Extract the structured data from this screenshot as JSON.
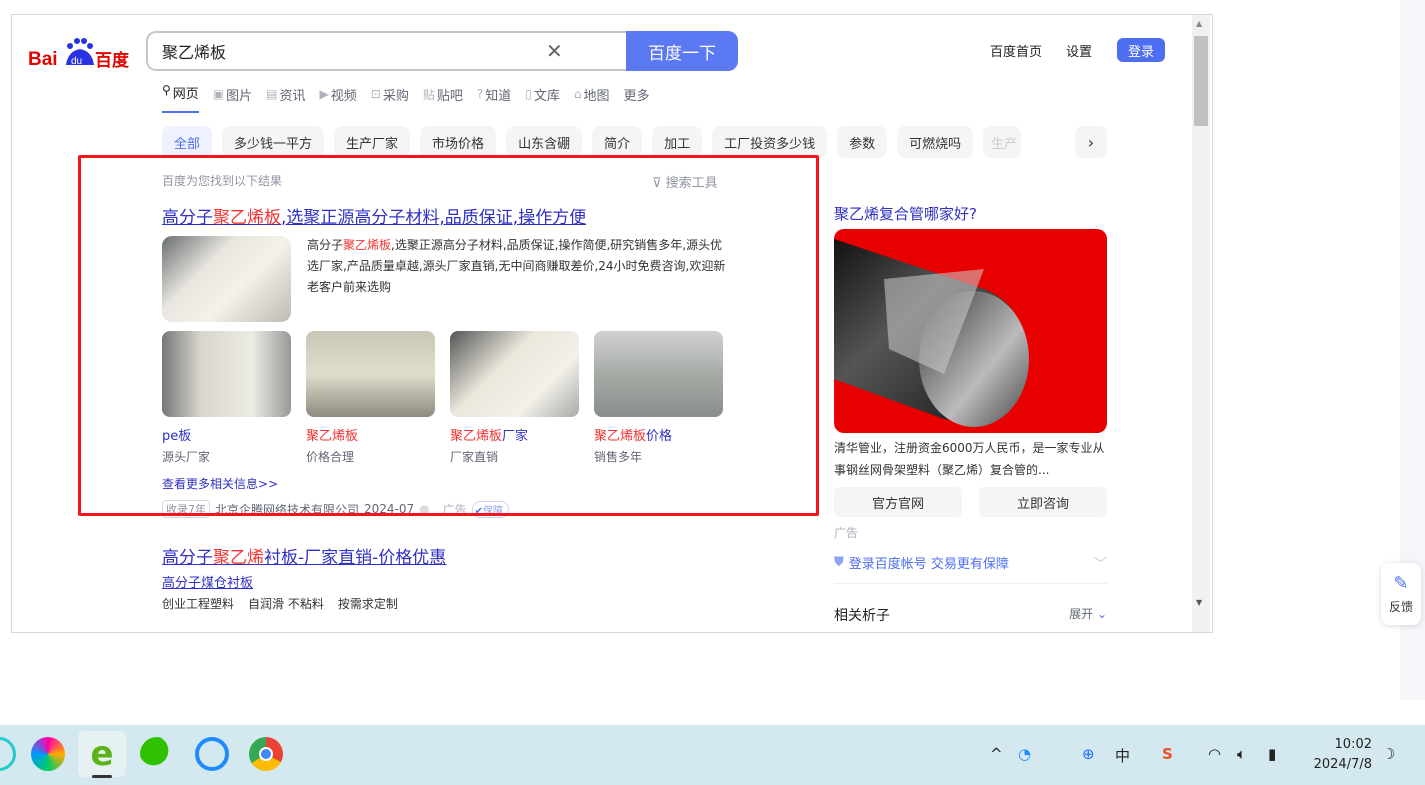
{
  "search": {
    "query": "聚乙烯板",
    "button": "百度一下",
    "logo_text": "Bai百度"
  },
  "top_links": {
    "home": "百度首页",
    "settings": "设置",
    "login": "登录"
  },
  "tabs": [
    {
      "label": "网页",
      "icon": "search-icon"
    },
    {
      "label": "图片",
      "icon": "image-icon"
    },
    {
      "label": "资讯",
      "icon": "news-icon"
    },
    {
      "label": "视频",
      "icon": "video-icon"
    },
    {
      "label": "采购",
      "icon": "bag-icon"
    },
    {
      "label": "贴吧",
      "icon": "tieba-icon"
    },
    {
      "label": "知道",
      "icon": "question-icon"
    },
    {
      "label": "文库",
      "icon": "doc-icon"
    },
    {
      "label": "地图",
      "icon": "map-icon"
    },
    {
      "label": "更多",
      "icon": ""
    }
  ],
  "chips": [
    "全部",
    "多少钱一平方",
    "生产厂家",
    "市场价格",
    "山东含硼",
    "简介",
    "加工",
    "工厂投资多少钱",
    "参数",
    "可燃烧吗",
    "生产"
  ],
  "results_header": {
    "found": "百度为您找到以下结果",
    "tools": "搜索工具"
  },
  "result1": {
    "title_pre": "高分子",
    "title_hl": "聚乙烯板",
    "title_post": ",选聚正源高分子材料,品质保证,操作方便",
    "desc_pre": "高分子",
    "desc_hl": "聚乙烯板",
    "desc_post": ",选聚正源高分子材料,品质保证,操作简便,研究销售多年,源头优选厂家,产品质量卓越,源头厂家直销,无中间商赚取差价,24小时免费咨询,欢迎新老客户前来选购",
    "gallery": [
      {
        "hl": "",
        "label": "pe板",
        "sub": "源头厂家"
      },
      {
        "hl": "聚乙烯板",
        "label": "",
        "sub": "价格合理"
      },
      {
        "hl": "聚乙烯板",
        "label": "厂家",
        "sub": "厂家直销"
      },
      {
        "hl": "聚乙烯板",
        "label": "价格",
        "sub": "销售多年"
      }
    ],
    "more": "查看更多相关信息>>",
    "badge": "收录7年",
    "source": "北京企腾网络技术有限公司",
    "date": "2024-07",
    "ad": "广告",
    "guarantee": "保障"
  },
  "result2": {
    "title_pre": "高分子",
    "title_hl": "聚乙烯",
    "title_post": "衬板-厂家直销-价格优惠",
    "sub": "高分子煤仓衬板",
    "tags": [
      "创业工程塑料",
      "自润滑 不粘料",
      "按需求定制"
    ]
  },
  "sidebar": {
    "title": "聚乙烯复合管哪家好?",
    "desc": "清华管业，注册资金6000万人民币，是一家专业从事钢丝网骨架塑料（聚乙烯）复合管的...",
    "btn1": "官方官网",
    "btn2": "立即咨询",
    "ad": "广告",
    "guard": "登录百度帐号 交易更有保障",
    "related": "相关析子",
    "expand": "展开"
  },
  "feedback": "反馈",
  "clock": {
    "time": "10:02",
    "date": "2024/7/8"
  },
  "tray": {
    "chevron": "^",
    "ime": "中"
  },
  "colors": {
    "accent": "#4e6ef2",
    "highlight": "#f73131",
    "link": "#3030c4",
    "annotation": "#f5141c"
  }
}
